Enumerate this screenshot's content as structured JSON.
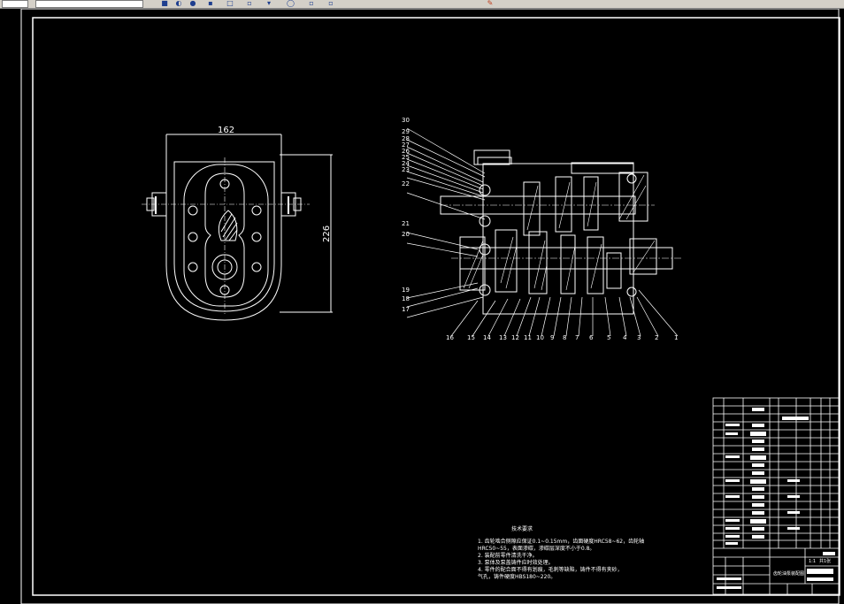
{
  "toolbar": {
    "icons": [
      "layer-icon",
      "undo-icon",
      "redo-icon",
      "print-icon",
      "copy-icon",
      "paste-icon",
      "zoom-icon",
      "pan-icon",
      "properties-icon",
      "help-icon"
    ]
  },
  "drawing": {
    "dim_width": "162",
    "dim_height": "226",
    "part_labels_left": [
      "30",
      "29",
      "28",
      "27",
      "26",
      "25",
      "24",
      "23",
      "22",
      "21",
      "20",
      "19",
      "18",
      "17"
    ],
    "part_labels_bottom": [
      "16",
      "15",
      "14",
      "13",
      "12",
      "11",
      "10",
      "9",
      "8",
      "7",
      "6",
      "5",
      "4",
      "3",
      "2",
      "1"
    ],
    "notes": {
      "title": "技术要求",
      "line1": "1. 齿轮啮合侧隙应保证0.1~0.15mm，齿面硬度HRC58~62，齿轮轴",
      "line2": "HRC50~55，表面渗碳，渗碳层深度不小于0.8。",
      "line3": "2. 装配前零件清洗干净。",
      "line4": "3. 泵体及泵盖铸件应时效处理。",
      "line5": "4. 零件的配合面不得有划痕，毛刺等缺陷，铸件不得有夹砂，",
      "line6": "气孔，铸件硬度HBS180~220。"
    },
    "title_block": {
      "part_name": "齿轮油泵装配图",
      "scale": "1:1",
      "sheet": "共1张"
    }
  }
}
